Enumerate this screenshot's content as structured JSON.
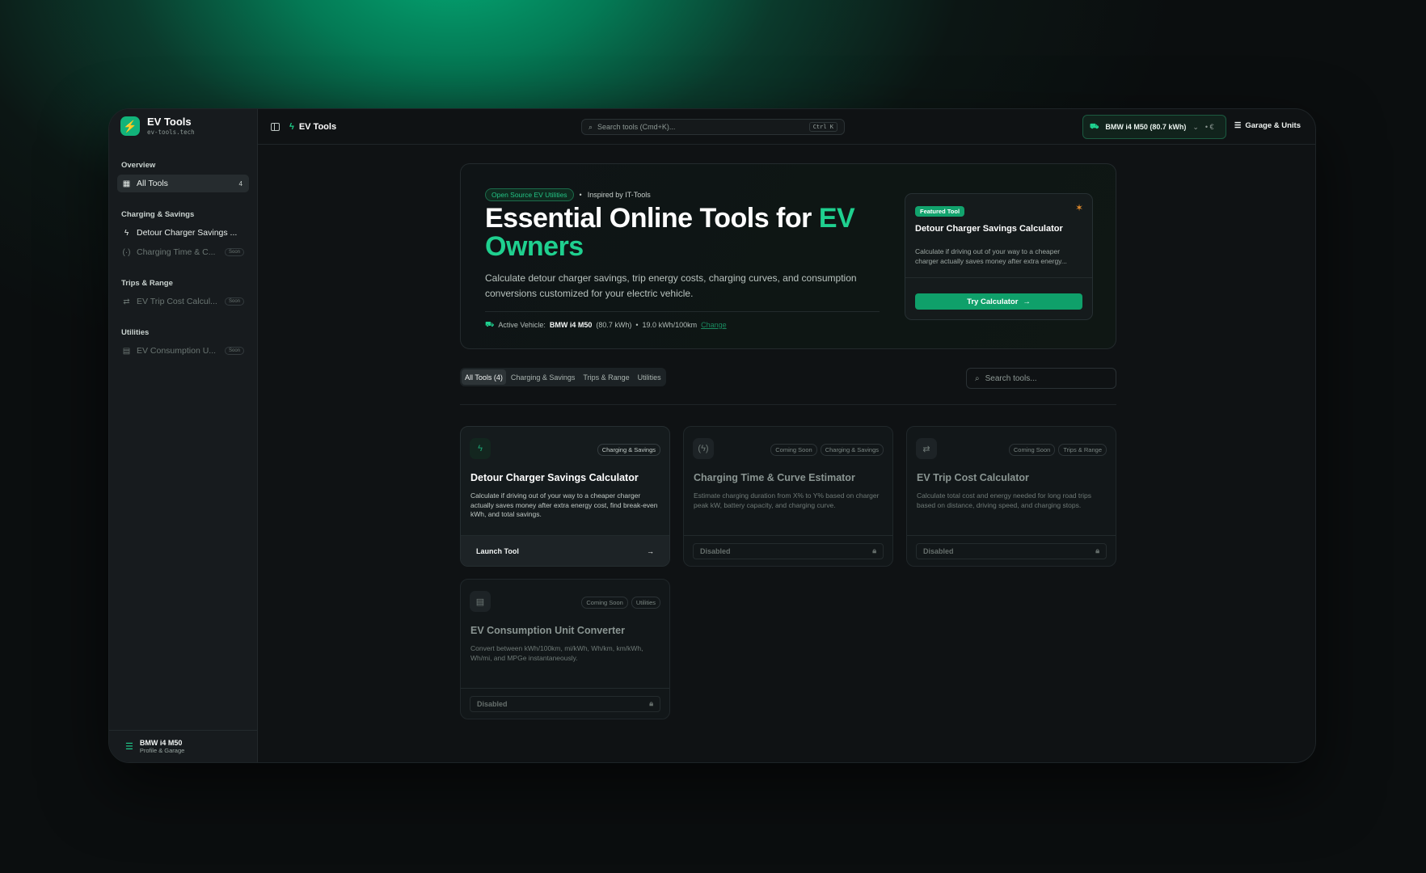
{
  "brand": {
    "name": "EV Tools",
    "domain": "ev-tools.tech",
    "icon": "bolt-icon"
  },
  "sidebar": {
    "groups": [
      {
        "label": "Overview",
        "items": [
          {
            "label": "All Tools",
            "badge": "4",
            "icon": "grid-icon",
            "active": true
          }
        ]
      },
      {
        "label": "Charging & Savings",
        "items": [
          {
            "label": "Detour Charger Savings ...",
            "icon": "bolt-icon",
            "active": false
          },
          {
            "label": "Charging Time & C...",
            "soon": "Soon",
            "icon": "charging-icon"
          }
        ]
      },
      {
        "label": "Trips & Range",
        "items": [
          {
            "label": "EV Trip Cost Calcul...",
            "soon": "Soon",
            "icon": "route-icon"
          }
        ]
      },
      {
        "label": "Utilities",
        "items": [
          {
            "label": "EV Consumption U...",
            "soon": "Soon",
            "icon": "calculator-icon"
          }
        ]
      }
    ],
    "footer": {
      "name": "BMW i4 M50",
      "sub": "Profile & Garage"
    }
  },
  "topbar": {
    "title": "EV Tools",
    "search_placeholder": "Search tools (Cmd+K)...",
    "shortcut": "Ctrl K",
    "vehicle": "BMW i4 M50 (80.7 kWh)",
    "currency": "• €",
    "garage_label": "Garage & Units"
  },
  "hero": {
    "badge": "Open Source EV Utilities",
    "inspired": "Inspired by IT-Tools",
    "title_main": "Essential Online Tools for ",
    "title_accent": "EV Owners",
    "description": "Calculate detour charger savings, trip energy costs, charging curves, and consumption conversions customized for your electric vehicle.",
    "active_label": "Active Vehicle:",
    "vehicle_name": "BMW i4 M50",
    "vehicle_capacity": "(80.7 kWh)",
    "vehicle_efficiency": "19.0 kWh/100km",
    "change_label": "Change",
    "featured": {
      "badge": "Featured Tool",
      "title": "Detour Charger Savings Calculator",
      "description": "Calculate if driving out of your way to a cheaper charger actually saves money after extra energy...",
      "button": "Try Calculator"
    }
  },
  "filters": {
    "tabs": [
      "All Tools (4)",
      "Charging & Savings",
      "Trips & Range",
      "Utilities"
    ],
    "active_tab": 0,
    "search_placeholder": "Search tools..."
  },
  "tools": [
    {
      "title": "Detour Charger Savings Calculator",
      "tags": [
        "Charging & Savings"
      ],
      "description": "Calculate if driving out of your way to a cheaper charger actually saves money after extra energy cost, find break-even kWh, and total savings.",
      "button": "Launch Tool",
      "enabled": true,
      "icon": "bolt-icon"
    },
    {
      "title": "Charging Time & Curve Estimator",
      "tags": [
        "Coming Soon",
        "Charging & Savings"
      ],
      "description": "Estimate charging duration from X% to Y% based on charger peak kW, battery capacity, and charging curve.",
      "button": "Disabled",
      "enabled": false,
      "icon": "charging-icon"
    },
    {
      "title": "EV Trip Cost Calculator",
      "tags": [
        "Coming Soon",
        "Trips & Range"
      ],
      "description": "Calculate total cost and energy needed for long road trips based on distance, driving speed, and charging stops.",
      "button": "Disabled",
      "enabled": false,
      "icon": "route-icon"
    },
    {
      "title": "EV Consumption Unit Converter",
      "tags": [
        "Coming Soon",
        "Utilities"
      ],
      "description": "Convert between kWh/100km, mi/kWh, Wh/km, km/kWh, Wh/mi, and MPGe instantaneously.",
      "button": "Disabled",
      "enabled": false,
      "icon": "calculator-icon"
    }
  ],
  "colors": {
    "accent": "#1fd08f",
    "button": "#0fa06a",
    "featured_star": "#e08a2c"
  }
}
